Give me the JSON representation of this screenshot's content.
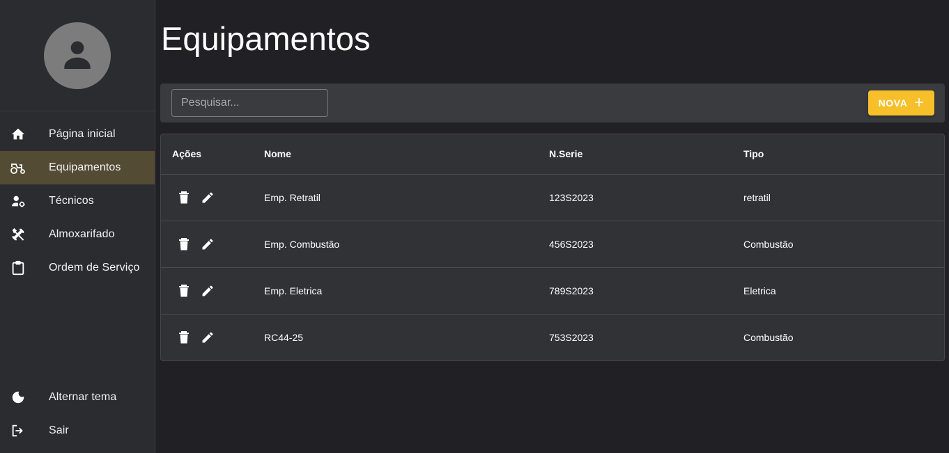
{
  "sidebar": {
    "avatar_icon": "person-icon",
    "items": [
      {
        "label": "Página inicial",
        "icon": "home-icon"
      },
      {
        "label": "Equipamentos",
        "icon": "tractor-icon"
      },
      {
        "label": "Técnicos",
        "icon": "user-gear-icon"
      },
      {
        "label": "Almoxarifado",
        "icon": "tools-icon"
      },
      {
        "label": "Ordem de Serviço",
        "icon": "clipboard-icon"
      }
    ],
    "bottom_items": [
      {
        "label": "Alternar tema",
        "icon": "moon-icon"
      },
      {
        "label": "Sair",
        "icon": "logout-icon"
      }
    ],
    "active_index": 1
  },
  "page": {
    "title": "Equipamentos"
  },
  "toolbar": {
    "search_placeholder": "Pesquisar...",
    "search_value": "",
    "new_label": "NOVA"
  },
  "table": {
    "columns": [
      "Ações",
      "Nome",
      "N.Serie",
      "Tipo"
    ],
    "rows": [
      {
        "nome": "Emp. Retratil",
        "serie": "123S2023",
        "tipo": "retratil"
      },
      {
        "nome": "Emp. Combustão",
        "serie": "456S2023",
        "tipo": "Combustão"
      },
      {
        "nome": "Emp. Eletrica",
        "serie": "789S2023",
        "tipo": "Eletrica"
      },
      {
        "nome": "RC44-25",
        "serie": "753S2023",
        "tipo": "Combustão"
      }
    ]
  },
  "colors": {
    "background": "#212125",
    "sidebar": "#2b2c30",
    "active_item": "#544b35",
    "accent": "#f7bf2a",
    "surface": "#313236"
  }
}
